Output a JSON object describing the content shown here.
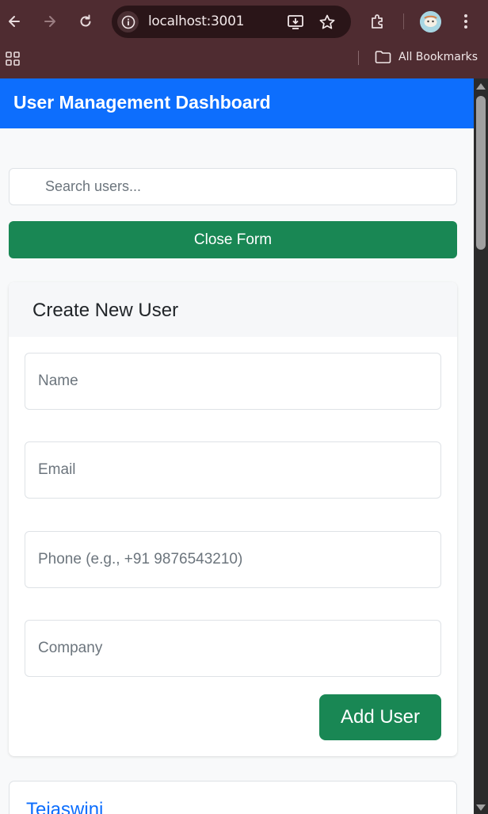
{
  "browser": {
    "url": "localhost:3001",
    "bookmarks_label": "All Bookmarks",
    "icons": [
      "back-arrow-icon",
      "forward-arrow-icon",
      "reload-icon",
      "site-info-icon",
      "install-app-icon",
      "bookmark-star-icon",
      "extensions-puzzle-icon",
      "profile-avatar",
      "more-menu-icon",
      "apps-grid-icon",
      "folder-icon"
    ]
  },
  "page": {
    "navbar_title": "User Management Dashboard",
    "search": {
      "placeholder": "Search users...",
      "value": ""
    },
    "toggle_form_label": "Close Form",
    "form": {
      "title": "Create New User",
      "fields": [
        {
          "placeholder": "Name",
          "value": ""
        },
        {
          "placeholder": "Email",
          "value": ""
        },
        {
          "placeholder": "Phone (e.g., +91 9876543210)",
          "value": ""
        },
        {
          "placeholder": "Company",
          "value": ""
        }
      ],
      "submit_label": "Add User"
    },
    "users": [
      {
        "name": "Tejaswini"
      }
    ]
  },
  "colors": {
    "primary": "#0d6efd",
    "success": "#198754",
    "browser_frame": "#4f2c31",
    "page_background": "#f8f9fa"
  }
}
